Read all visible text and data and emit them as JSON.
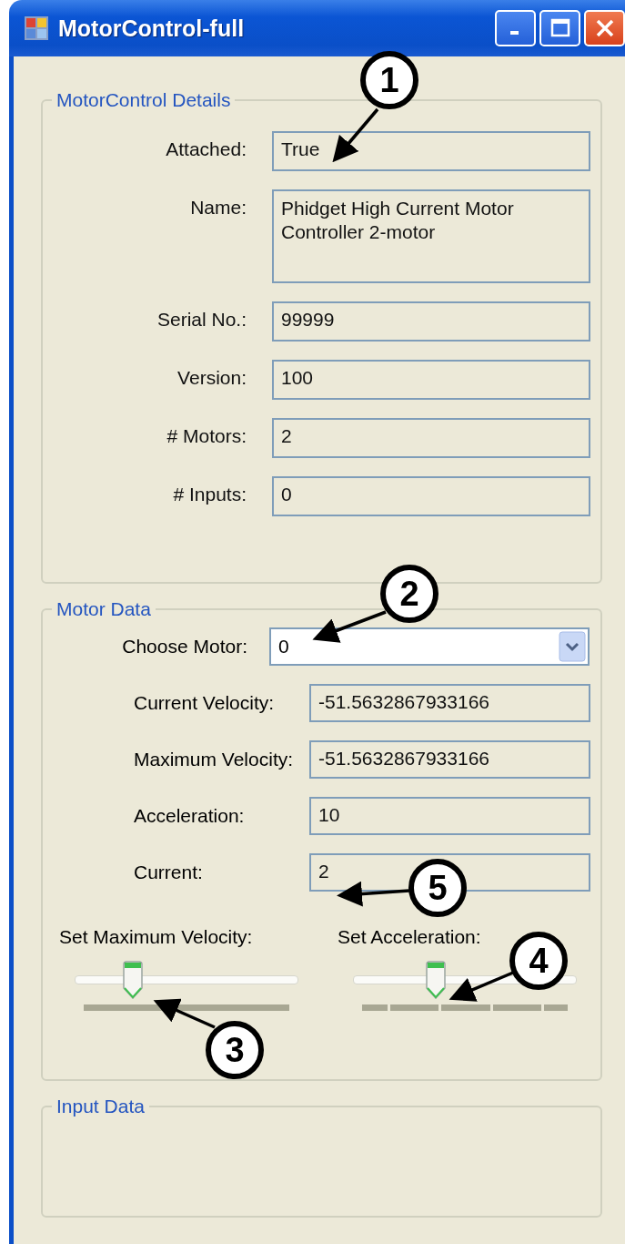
{
  "window": {
    "title": "MotorControl-full"
  },
  "details": {
    "title": "MotorControl Details",
    "rows": [
      {
        "label": "Attached:",
        "value": "True",
        "kind": "single"
      },
      {
        "label": "Name:",
        "value": "Phidget High Current Motor Controller 2-motor",
        "kind": "multiline"
      },
      {
        "label": "Serial No.:",
        "value": "99999",
        "kind": "single"
      },
      {
        "label": "Version:",
        "value": "100",
        "kind": "single"
      },
      {
        "label": "# Motors:",
        "value": "2",
        "kind": "single"
      },
      {
        "label": "# Inputs:",
        "value": "0",
        "kind": "single"
      }
    ]
  },
  "motor_data": {
    "title": "Motor Data",
    "choose_label": "Choose Motor:",
    "choose_value": "0",
    "rows": [
      {
        "label": "Current Velocity:",
        "value": "-51.5632867933166"
      },
      {
        "label": "Maximum Velocity:",
        "value": "-51.5632867933166"
      },
      {
        "label": "Acceleration:",
        "value": "10"
      },
      {
        "label": "Current:",
        "value": "2"
      }
    ],
    "sliders": [
      {
        "label": "Set Maximum Velocity:",
        "level": 0.26,
        "kind": "dense"
      },
      {
        "label": "Set Acceleration:",
        "level": 0.37,
        "kind": "sparse"
      }
    ]
  },
  "input_data": {
    "title": "Input Data"
  },
  "callouts": [
    "1",
    "2",
    "3",
    "4",
    "5"
  ]
}
